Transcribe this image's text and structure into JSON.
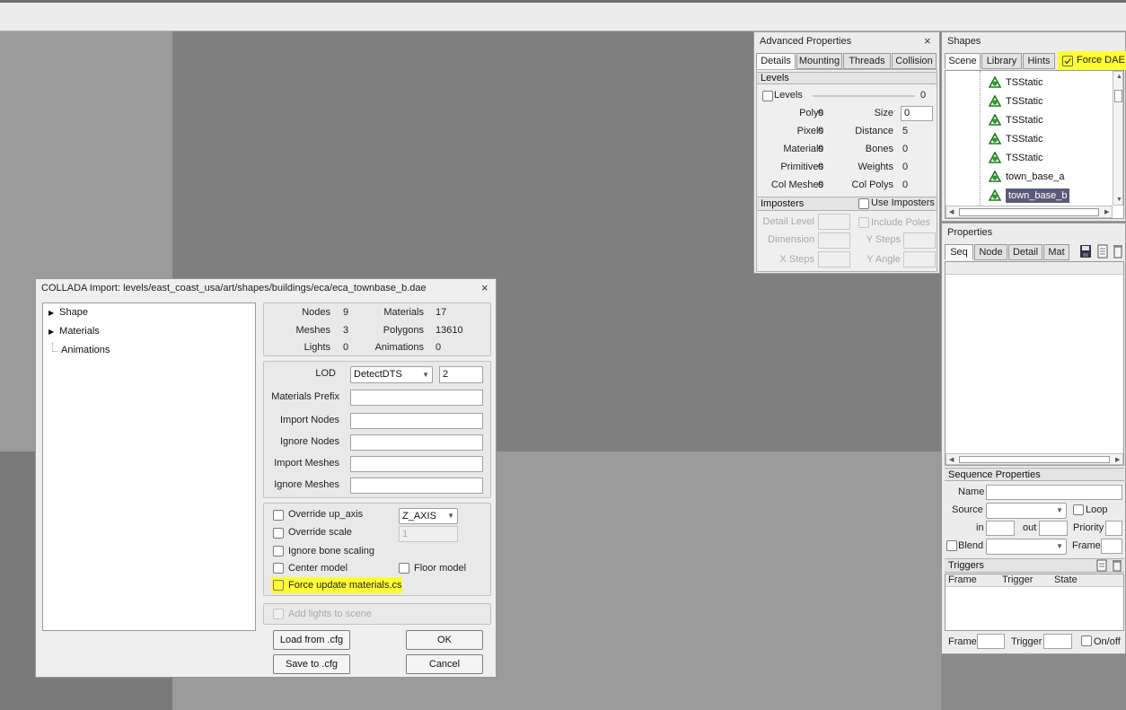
{
  "adv": {
    "title": "Advanced Properties",
    "close": "×",
    "tabs": [
      "Details",
      "Mounting",
      "Threads",
      "Collision"
    ],
    "levels_header": "Levels",
    "levels_check": "Levels",
    "levels_value": "0",
    "stats_left": [
      {
        "label": "Polys",
        "value": "0"
      },
      {
        "label": "Pixels",
        "value": "0"
      },
      {
        "label": "Materials",
        "value": "0"
      },
      {
        "label": "Primitives",
        "value": "0"
      },
      {
        "label": "Col Meshes",
        "value": "0"
      }
    ],
    "size_label": "Size",
    "size_value": "0",
    "stats_right": [
      {
        "label": "Distance",
        "value": "5"
      },
      {
        "label": "Bones",
        "value": "0"
      },
      {
        "label": "Weights",
        "value": "0"
      },
      {
        "label": "Col Polys",
        "value": "0"
      }
    ],
    "imposters_header": "Imposters",
    "use_imposters": "Use Imposters",
    "detail_level": "Detail Level",
    "include_poles": "Include Poles",
    "dimension": "Dimension",
    "y_steps": "Y Steps",
    "x_steps": "X Steps",
    "y_angle": "Y Angle"
  },
  "shapes": {
    "title": "Shapes",
    "tabs": [
      "Scene",
      "Library",
      "Hints"
    ],
    "force_dae": "Force DAE",
    "tree": [
      "TSStatic",
      "TSStatic",
      "TSStatic",
      "TSStatic",
      "TSStatic",
      "town_base_a",
      "town_base_b"
    ]
  },
  "props": {
    "title": "Properties",
    "tabs": [
      "Seq",
      "Node",
      "Detail",
      "Mat"
    ],
    "seq_props": "Sequence Properties",
    "name": "Name",
    "source": "Source",
    "loop": "Loop",
    "in": "in",
    "out": "out",
    "priority": "Priority",
    "blend": "Blend",
    "frame": "Frame",
    "triggers": "Triggers",
    "trig_cols": [
      "Frame",
      "Trigger",
      "State"
    ],
    "b_frame": "Frame",
    "b_trigger": "Trigger",
    "b_onoff": "On/off"
  },
  "dialog": {
    "title": "COLLADA Import: levels/east_coast_usa/art/shapes/buildings/eca/eca_townbase_b.dae",
    "close": "×",
    "tree": [
      "Shape",
      "Materials",
      "Animations"
    ],
    "stats": {
      "nodes_label": "Nodes",
      "nodes": "9",
      "materials_label": "Materials",
      "materials": "17",
      "meshes_label": "Meshes",
      "meshes": "3",
      "polygons_label": "Polygons",
      "polygons": "13610",
      "lights_label": "Lights",
      "lights": "0",
      "animations_label": "Animations",
      "animations": "0"
    },
    "lod_label": "LOD",
    "lod_select": "DetectDTS",
    "lod_value": "2",
    "fields": [
      "Materials Prefix",
      "Import Nodes",
      "Ignore Nodes",
      "Import Meshes",
      "Ignore Meshes"
    ],
    "override_up": "Override up_axis",
    "up_axis": "Z_AXIS",
    "override_scale": "Override scale",
    "scale_value": "1",
    "ignore_bone": "Ignore bone scaling",
    "center_model": "Center model",
    "floor_model": "Floor model",
    "force_update": "Force update materials.cs",
    "add_lights": "Add lights to scene",
    "load_cfg": "Load from .cfg",
    "save_cfg": "Save to .cfg",
    "ok": "OK",
    "cancel": "Cancel"
  },
  "colors": {
    "highlight": "#ffff33",
    "selection": "#5a5a7a"
  }
}
